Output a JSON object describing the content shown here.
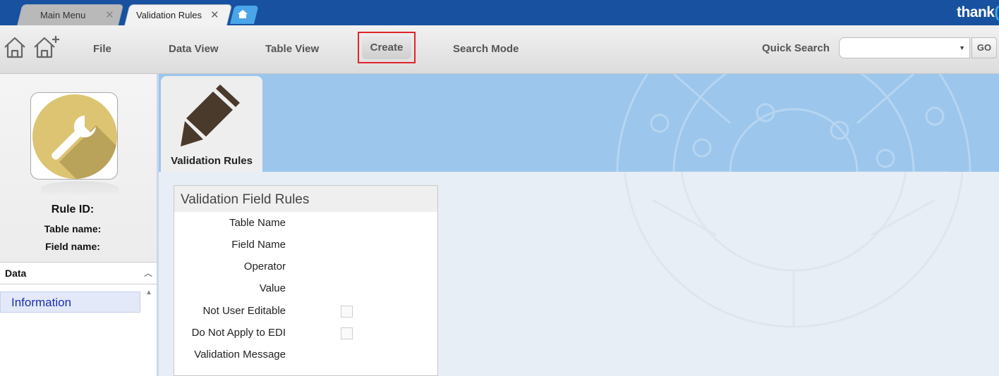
{
  "tabs": {
    "main_menu": "Main Menu",
    "validation_rules": "Validation Rules",
    "close_glyph": "✕"
  },
  "brand": "thank",
  "toolbar": {
    "file": "File",
    "data_view": "Data View",
    "table_view": "Table View",
    "create": "Create",
    "search_mode": "Search Mode",
    "quick_search_label": "Quick Search",
    "quick_search_value": "",
    "go": "GO"
  },
  "sidebar": {
    "rule_id_label": "Rule ID:",
    "table_name_label": "Table name:",
    "field_name_label": "Field name:",
    "section_label": "Data",
    "items": [
      {
        "label": "Information"
      }
    ]
  },
  "app_tile": {
    "title": "Validation Rules",
    "icon": "pencil-icon"
  },
  "panel": {
    "title": "Validation Field Rules",
    "fields": [
      {
        "label": "Table Name"
      },
      {
        "label": "Field Name"
      },
      {
        "label": "Operator"
      },
      {
        "label": "Value"
      },
      {
        "label": "Not User Editable",
        "checked": false
      },
      {
        "label": "Do Not Apply to EDI",
        "checked": false
      },
      {
        "label": "Validation Message"
      }
    ]
  },
  "colors": {
    "titlebar": "#1751a0",
    "highlight_border": "#e0242b",
    "info_link": "#1c2fb5",
    "banner": "#9cc6ec"
  }
}
